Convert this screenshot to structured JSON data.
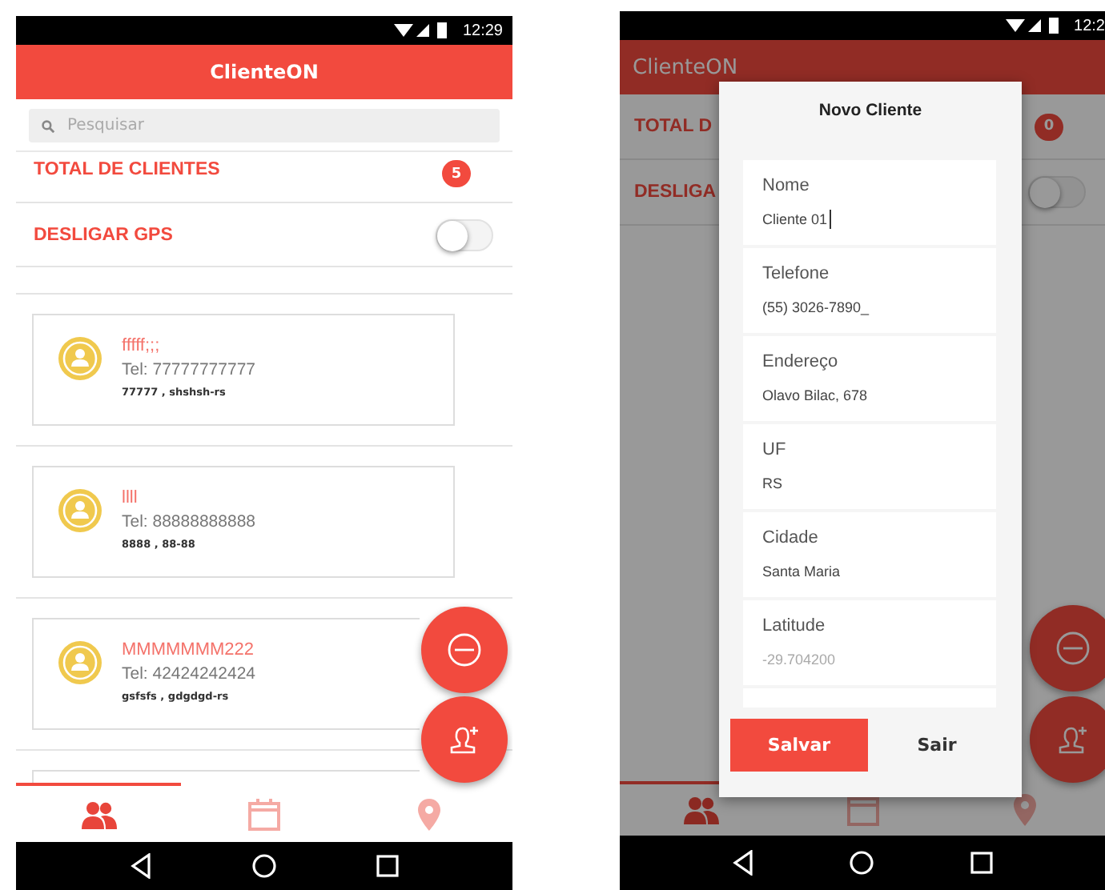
{
  "left_screen": {
    "status_bar": {
      "time": "12:29"
    },
    "app_bar": {
      "title": "ClienteON"
    },
    "search": {
      "placeholder": "Pesquisar"
    },
    "total": {
      "label": "TOTAL DE CLIENTES",
      "count": "5"
    },
    "gps": {
      "label": "DESLIGAR GPS",
      "on": false
    },
    "clients": [
      {
        "name": "fffff;;;",
        "phone": "Tel: 77777777777",
        "address": "77777 , shshsh-rs"
      },
      {
        "name": "llll",
        "phone": "Tel: 88888888888",
        "address": "8888 , 88-88"
      },
      {
        "name": "MMMMMMM222",
        "phone": "Tel: 42424242424",
        "address": "gsfsfs , gdgdgd-rs"
      },
      {
        "kind": "partial"
      }
    ],
    "bottom_tabs": [
      {
        "kind": "clients",
        "selected": true
      },
      {
        "kind": "calendar",
        "selected": false
      },
      {
        "kind": "location",
        "selected": false
      }
    ]
  },
  "right_screen": {
    "status_bar": {
      "time": "12:2"
    },
    "app_bar": {
      "title": "ClienteON"
    },
    "total": {
      "label": "TOTAL D",
      "count": "0"
    },
    "gps": {
      "label": "DESLIGA",
      "on": false
    },
    "bottom_tabs": [
      {
        "kind": "clients",
        "selected": true
      },
      {
        "kind": "calendar",
        "selected": false
      },
      {
        "kind": "location",
        "selected": false
      }
    ],
    "dialog": {
      "title": "Novo Cliente",
      "fields": [
        {
          "label": "Nome",
          "value": "Cliente 01",
          "focused": true
        },
        {
          "label": "Telefone",
          "value": "(55) 3026-7890_",
          "focused": false
        },
        {
          "label": "Endereço",
          "value": "Olavo Bilac, 678",
          "focused": false
        },
        {
          "label": "UF",
          "value": "RS",
          "focused": false
        },
        {
          "label": "Cidade",
          "value": "Santa Maria",
          "focused": false
        },
        {
          "label": "Latitude",
          "placeholder": "-29.704200",
          "focused": false
        },
        {
          "kind": "partial"
        }
      ],
      "buttons": [
        {
          "label": "Salvar",
          "kind": "primary"
        },
        {
          "label": "Sair",
          "kind": "secondary"
        }
      ]
    }
  }
}
